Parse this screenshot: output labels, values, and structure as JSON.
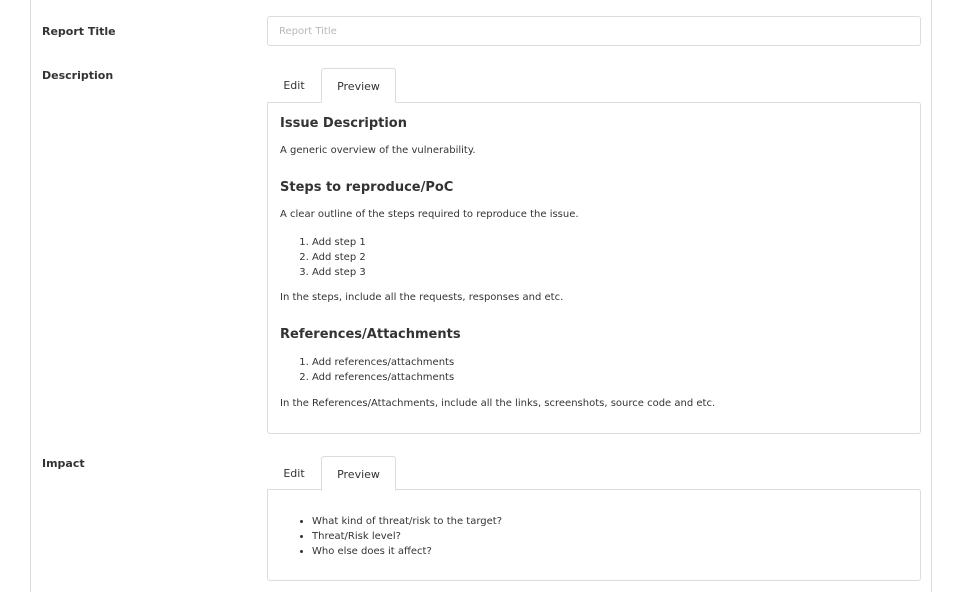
{
  "form": {
    "report_title": {
      "label": "Report Title",
      "value": "",
      "placeholder": "Report Title"
    },
    "description": {
      "label": "Description",
      "tabs": [
        {
          "label": "Edit",
          "active": false
        },
        {
          "label": "Preview",
          "active": true
        }
      ],
      "preview": {
        "issue_heading": "Issue Description",
        "issue_text": "A generic overview of the vulnerability.",
        "steps_heading": "Steps to reproduce/PoC",
        "steps_text": "A clear outline of the steps required to reproduce the issue.",
        "steps": [
          "Add step 1",
          "Add step 2",
          "Add step 3"
        ],
        "steps_note": "In the steps, include all the requests, responses and etc.",
        "refs_heading": "References/Attachments",
        "refs": [
          "Add references/attachments",
          "Add references/attachments"
        ],
        "refs_note": "In the References/Attachments, include all the links, screenshots, source code and etc."
      }
    },
    "impact": {
      "label": "Impact",
      "tabs": [
        {
          "label": "Edit",
          "active": false
        },
        {
          "label": "Preview",
          "active": true
        }
      ],
      "preview": {
        "bullets": [
          "What kind of threat/risk to the target?",
          "Threat/Risk level?",
          "Who else does it affect?"
        ]
      }
    }
  },
  "colors": {
    "border": "#dcdcdc",
    "text": "#333333",
    "placeholder": "#b8b8b8"
  }
}
